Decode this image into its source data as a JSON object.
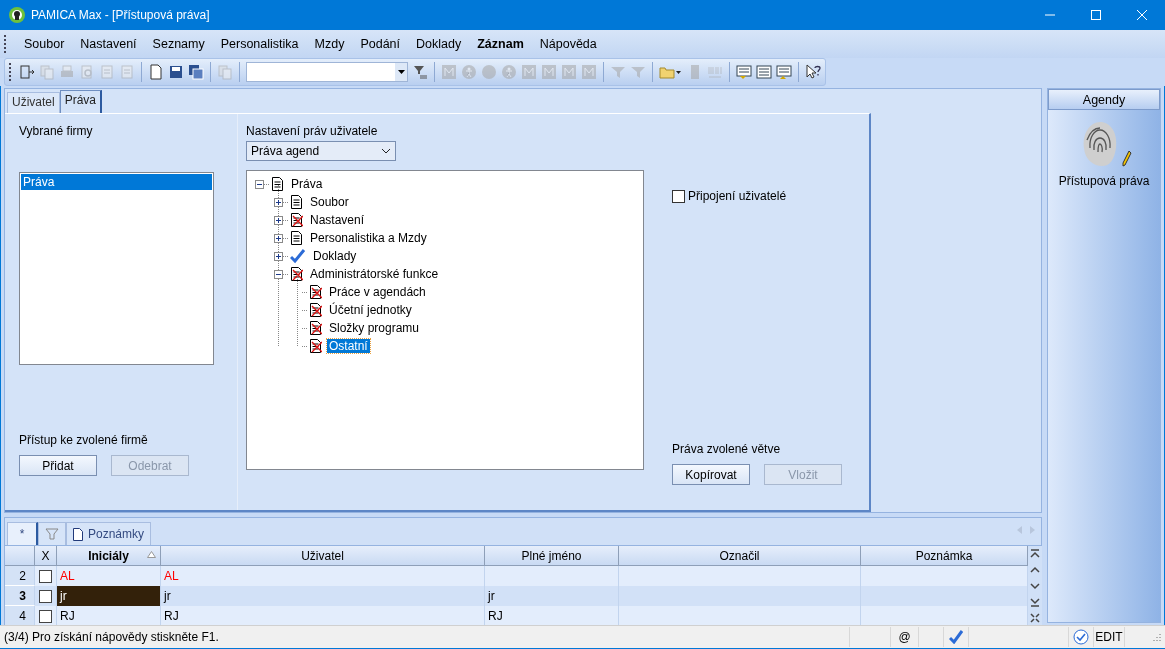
{
  "window": {
    "title": "PAMICA Max - [Přístupová práva]"
  },
  "menu": [
    {
      "label": "Soubor",
      "emphasized": false
    },
    {
      "label": "Nastavení",
      "emphasized": false
    },
    {
      "label": "Seznamy",
      "emphasized": false
    },
    {
      "label": "Personalistika",
      "emphasized": false
    },
    {
      "label": "Mzdy",
      "emphasized": false
    },
    {
      "label": "Podání",
      "emphasized": false
    },
    {
      "label": "Doklady",
      "emphasized": false
    },
    {
      "label": "Záznam",
      "emphasized": true
    },
    {
      "label": "Nápověda",
      "emphasized": false
    }
  ],
  "toolbar": [
    {
      "kind": "door",
      "disabled": false
    },
    {
      "kind": "copies",
      "disabled": true
    },
    {
      "kind": "printer",
      "disabled": true
    },
    {
      "kind": "preview",
      "disabled": true
    },
    {
      "kind": "page",
      "disabled": true
    },
    {
      "kind": "page",
      "disabled": true
    },
    {
      "kind": "separator"
    },
    {
      "kind": "new",
      "disabled": false
    },
    {
      "kind": "save",
      "disabled": false
    },
    {
      "kind": "saveall",
      "disabled": false
    },
    {
      "kind": "separator"
    },
    {
      "kind": "copies",
      "disabled": true
    },
    {
      "kind": "separator"
    },
    {
      "kind": "combo"
    },
    {
      "kind": "filterlist",
      "disabled": false
    },
    {
      "kind": "separator"
    },
    {
      "kind": "m",
      "disabled": true
    },
    {
      "kind": "person",
      "disabled": true
    },
    {
      "kind": "dot",
      "disabled": true
    },
    {
      "kind": "person",
      "disabled": true
    },
    {
      "kind": "m",
      "disabled": true
    },
    {
      "kind": "m",
      "disabled": true
    },
    {
      "kind": "m",
      "disabled": true
    },
    {
      "kind": "m",
      "disabled": true
    },
    {
      "kind": "separator"
    },
    {
      "kind": "funnel",
      "disabled": true
    },
    {
      "kind": "funnel",
      "disabled": true
    },
    {
      "kind": "separator"
    },
    {
      "kind": "folder",
      "disabled": false
    },
    {
      "kind": "block",
      "disabled": true
    },
    {
      "kind": "barcode",
      "disabled": true
    },
    {
      "kind": "separator"
    },
    {
      "kind": "listdown",
      "disabled": false
    },
    {
      "kind": "list",
      "disabled": false
    },
    {
      "kind": "listup",
      "disabled": false
    },
    {
      "kind": "separator"
    },
    {
      "kind": "help",
      "disabled": false
    }
  ],
  "tabs": [
    {
      "label": "Uživatel",
      "selected": false
    },
    {
      "label": "Práva",
      "selected": true
    }
  ],
  "firms": {
    "title": "Vybrané firmy",
    "items": [
      {
        "label": "Práva",
        "selected": true
      }
    ],
    "access_label": "Přístup ke zvolené firmě",
    "buttons": [
      {
        "label": "Přidat",
        "disabled": false
      },
      {
        "label": "Odebrat",
        "disabled": true
      }
    ]
  },
  "rights": {
    "title": "Nastavení práv uživatele",
    "dropdown": {
      "value": "Práva agend"
    },
    "tree": [
      {
        "label": "Práva",
        "kind": "page",
        "expanded": true,
        "selected": false,
        "children": [
          {
            "label": "Soubor",
            "kind": "page",
            "expanded": false,
            "selected": false
          },
          {
            "label": "Nastavení",
            "kind": "denied",
            "expanded": false,
            "selected": false
          },
          {
            "label": "Personalistika a Mzdy",
            "kind": "page",
            "expanded": false,
            "selected": false
          },
          {
            "label": "Doklady",
            "kind": "check",
            "expanded": false,
            "selected": false
          },
          {
            "label": "Administrátorské funkce",
            "kind": "denied",
            "expanded": true,
            "selected": false,
            "children": [
              {
                "label": "Práce v agendách",
                "kind": "denied",
                "selected": false
              },
              {
                "label": "Účetní jednotky",
                "kind": "denied",
                "selected": false
              },
              {
                "label": "Složky programu",
                "kind": "denied",
                "selected": false
              },
              {
                "label": "Ostatní",
                "kind": "denied",
                "selected": true
              }
            ]
          }
        ]
      }
    ],
    "connected_users": {
      "label": "Připojení uživatelé",
      "checked": false
    },
    "branch_label": "Práva zvolené větve",
    "buttons": [
      {
        "label": "Kopírovat",
        "disabled": false
      },
      {
        "label": "Vložit",
        "disabled": true
      }
    ]
  },
  "bottom_tabs": [
    {
      "kind": "new",
      "label": "*",
      "selected": true
    },
    {
      "kind": "filter",
      "selected": false
    },
    {
      "kind": "notes",
      "label": "Poznámky",
      "selected": false
    }
  ],
  "grid": {
    "columns": [
      {
        "label": "X",
        "sorted": false
      },
      {
        "label": "Iniciály",
        "sorted": true
      },
      {
        "label": "Uživatel",
        "sorted": false
      },
      {
        "label": "Plné jméno",
        "sorted": false
      },
      {
        "label": "Označil",
        "sorted": false
      },
      {
        "label": "Poznámka",
        "sorted": false
      }
    ],
    "rows": [
      {
        "number": "2",
        "checked": false,
        "selected": false,
        "flagged": true,
        "cells": [
          "AL",
          "AL",
          "",
          "",
          ""
        ]
      },
      {
        "number": "3",
        "checked": false,
        "selected": true,
        "flagged": false,
        "cells": [
          "jr",
          "jr",
          "jr",
          "",
          ""
        ]
      },
      {
        "number": "4",
        "checked": false,
        "selected": false,
        "flagged": false,
        "cells": [
          "RJ",
          "RJ",
          "RJ",
          "",
          ""
        ]
      }
    ]
  },
  "agenda": {
    "title": "Agendy",
    "items": [
      {
        "label": "Přístupová práva"
      }
    ]
  },
  "status_bar": {
    "text": "(3/4) Pro získání nápovědy stiskněte F1.",
    "at": "@",
    "mode": "EDIT"
  }
}
